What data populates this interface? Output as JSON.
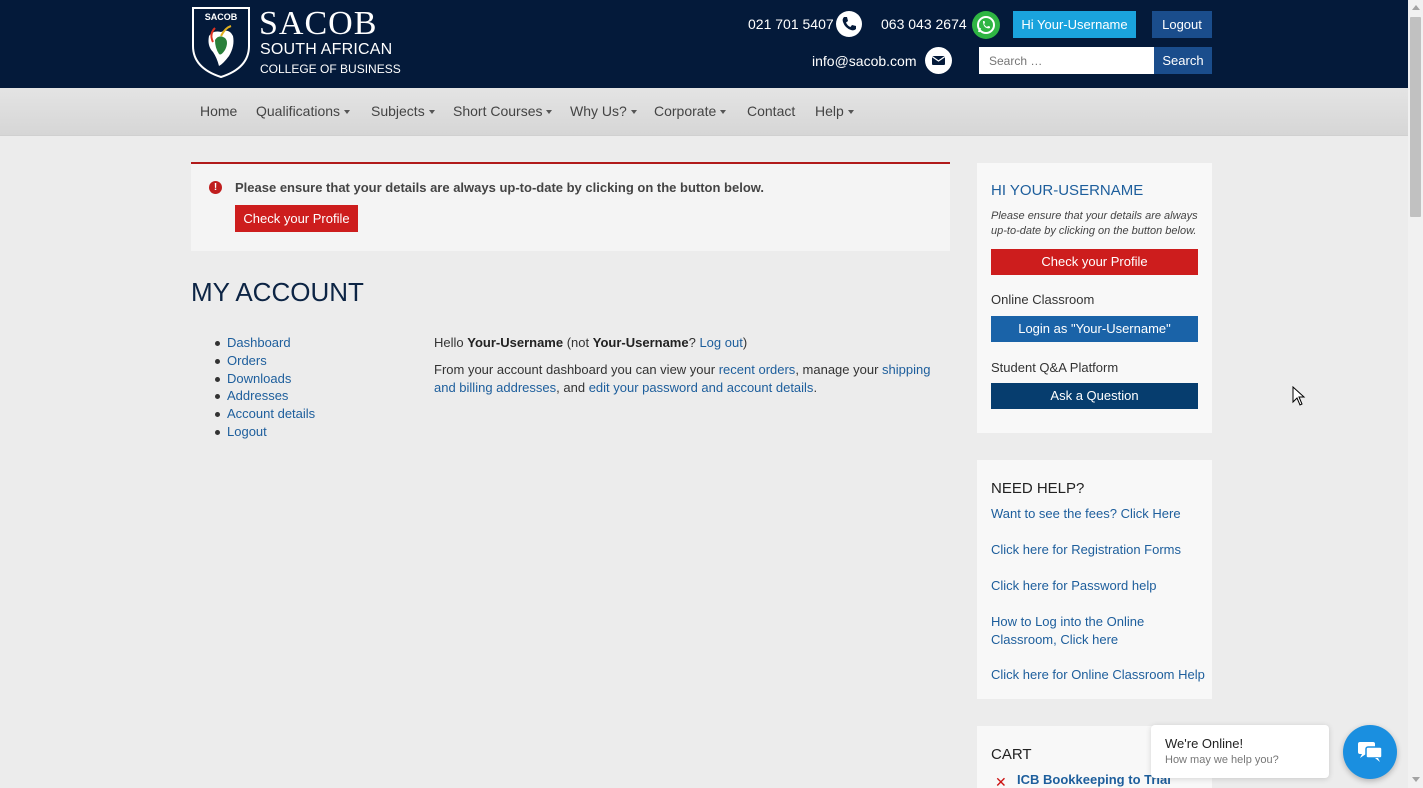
{
  "colors": {
    "header_bg": "#041a3a",
    "accent_blue": "#1a4d8c",
    "light_blue": "#1aa3dd",
    "danger_red": "#cd1d1d",
    "link": "#1d5e9c",
    "dark_navy_button": "#063d6e"
  },
  "header": {
    "logo": {
      "badge": "SACOB",
      "brand": "SACOB",
      "line1": "SOUTH AFRICAN",
      "line2": "COLLEGE OF BUSINESS"
    },
    "phone1": "021 701 5407",
    "phone1_icon": "phone-icon",
    "phone2": "063 043 2674",
    "phone2_icon": "whatsapp-icon",
    "greeting_button": "Hi Your-Username",
    "logout_button": "Logout",
    "email": "info@sacob.com",
    "email_icon": "mail-icon",
    "search": {
      "placeholder": "Search …",
      "button": "Search"
    }
  },
  "nav": {
    "items": [
      {
        "label": "Home",
        "dropdown": false
      },
      {
        "label": "Qualifications",
        "dropdown": true
      },
      {
        "label": "Subjects",
        "dropdown": true
      },
      {
        "label": "Short Courses",
        "dropdown": true
      },
      {
        "label": "Why Us?",
        "dropdown": true
      },
      {
        "label": "Corporate",
        "dropdown": true
      },
      {
        "label": "Contact",
        "dropdown": false
      },
      {
        "label": "Help",
        "dropdown": true
      }
    ]
  },
  "alert": {
    "text": "Please ensure that your details are always up-to-date by clicking on the button below.",
    "button": "Check your Profile"
  },
  "page_title": "MY ACCOUNT",
  "account_nav": [
    "Dashboard",
    "Orders",
    "Downloads",
    "Addresses",
    "Account details",
    "Logout"
  ],
  "dashboard": {
    "hello": "Hello",
    "username": "Your-Username",
    "not": "(not",
    "username2": "Your-Username",
    "q": "?",
    "logout_link": "Log out",
    "close": ")",
    "intro": "From your account dashboard you can view your",
    "recent_orders": "recent orders",
    "manage": ", manage your",
    "addresses": "shipping and billing addresses",
    "and": ", and",
    "edit": "edit your password and account details",
    "period": "."
  },
  "sidebar": {
    "profile": {
      "title": "HI YOUR-USERNAME",
      "desc": "Please ensure that your details are always up-to-date by clicking on the button below.",
      "profile_button": "Check your Profile",
      "classroom_label": "Online Classroom",
      "classroom_button": "Login as \"Your-Username\"",
      "qa_label": "Student Q&A Platform",
      "qa_button": "Ask a Question"
    },
    "help": {
      "title": "NEED HELP?",
      "links": [
        "Want to see the fees? Click Here",
        "Click here for Registration Forms",
        "Click here for Password help",
        "How to Log into the Online Classroom, Click here",
        "Click here for Online Classroom Help"
      ]
    },
    "cart": {
      "title": "CART",
      "item": "ICB Bookkeeping to Trial"
    }
  },
  "chat": {
    "title": "We're Online!",
    "subtitle": "How may we help you?",
    "icon": "chat-icon"
  }
}
